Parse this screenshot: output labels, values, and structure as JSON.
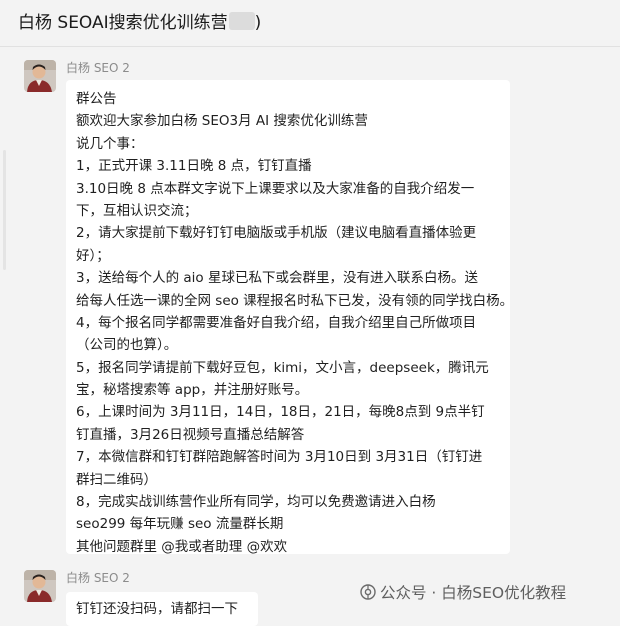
{
  "header": {
    "title_before": "白杨 SEOAI搜索优化训练营",
    "title_after": ")"
  },
  "messages": [
    {
      "sender": "白杨 SEO 2",
      "lines": [
        "群公告",
        "额欢迎大家参加白杨 SEO3月 AI 搜索优化训练营",
        "说几个事：",
        "1，正式开课 3.11日晚 8 点，钉钉直播",
        "3.10日晚 8 点本群文字说下上课要求以及大家准备的自我介绍发一",
        "下，互相认识交流；",
        "2，请大家提前下载好钉钉电脑版或手机版（建议电脑看直播体验更",
        "好）；",
        "3，送给每个人的 aio 星球已私下或会群里，没有进入联系白杨。送",
        "给每人任选一课的全网 seo 课程报名时私下已发，没有领的同学找白杨。",
        "4，每个报名同学都需要准备好自我介绍，自我介绍里自己所做项目",
        "（公司的也算）。",
        "5，报名同学请提前下载好豆包，kimi，文小言，deepseek，腾讯元",
        "宝，秘塔搜索等 app，并注册好账号。",
        "6，上课时间为 3月11日，14日，18日，21日，每晚8点到 9点半钉",
        "钉直播，3月26日视频号直播总结解答",
        "7，本微信群和钉钉群陪跑解答时间为 3月10日到 3月31日（钉钉进",
        "群扫二维码）",
        "8，完成实战训练营作业所有同学，均可以免费邀请进入白杨",
        "seo299 每年玩赚 seo 流量群长期",
        "其他问题群里 @我或者助理 @欢欢"
      ]
    },
    {
      "sender": "白杨 SEO 2",
      "lines": [
        "钉钉还没扫码，请都扫一下"
      ]
    }
  ],
  "watermark": {
    "icon": "wechat-official-account-icon",
    "text": "公众号 · 白杨SEO优化教程"
  },
  "colors": {
    "background": "#f3f3f3",
    "bubble": "#ffffff",
    "sender_text": "#8c8c8c"
  }
}
